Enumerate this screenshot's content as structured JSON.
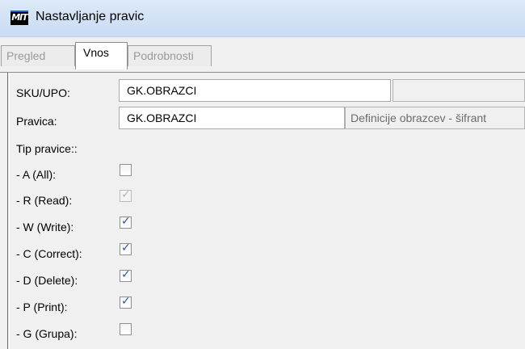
{
  "window": {
    "title": "Nastavljanje pravic",
    "icon": "mit-logo-icon"
  },
  "tabs": [
    {
      "label": "Pregled",
      "active": false
    },
    {
      "label": "Vnos",
      "active": true
    },
    {
      "label": "Podrobnosti",
      "active": false
    }
  ],
  "form": {
    "sku_label": "SKU/UPO:",
    "sku_value": "GK.OBRAZCI",
    "sku_desc": "",
    "pravica_label": "Pravica:",
    "pravica_value": "GK.OBRAZCI",
    "pravica_desc": "Definicije obrazcev - šifrant",
    "tip_label": "Tip pravice::"
  },
  "rights": [
    {
      "label": "- A (All):",
      "checked": false,
      "disabled": false
    },
    {
      "label": "- R (Read):",
      "checked": true,
      "disabled": true
    },
    {
      "label": "- W (Write):",
      "checked": true,
      "disabled": false
    },
    {
      "label": "- C (Correct):",
      "checked": true,
      "disabled": false
    },
    {
      "label": "- D (Delete):",
      "checked": true,
      "disabled": false
    },
    {
      "label": "- P (Print):",
      "checked": true,
      "disabled": false
    },
    {
      "label": "- G (Grupa):",
      "checked": false,
      "disabled": false
    }
  ],
  "colors": {
    "titlebar": "#c9dcf3",
    "check": "#3452a8"
  }
}
